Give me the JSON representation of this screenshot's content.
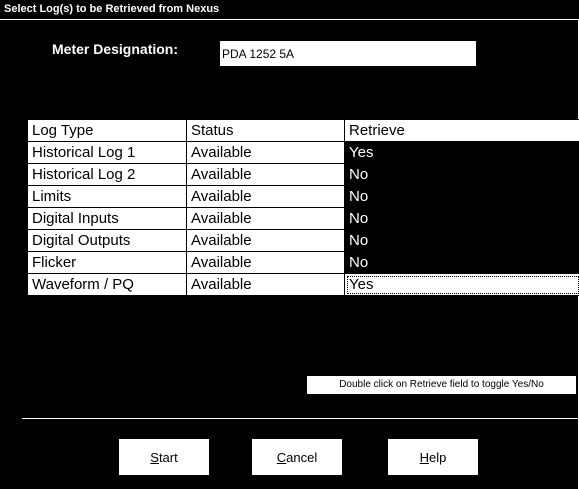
{
  "window": {
    "title": "Select Log(s) to be Retrieved from Nexus"
  },
  "meter": {
    "label": "Meter Designation:",
    "value": "PDA 1252 5A"
  },
  "table": {
    "headers": [
      "Log Type",
      "Status",
      "Retrieve"
    ],
    "rows": [
      [
        "Historical Log 1",
        "Available",
        "Yes"
      ],
      [
        "Historical Log 2",
        "Available",
        "No"
      ],
      [
        "Limits",
        "Available",
        "No"
      ],
      [
        "Digital Inputs",
        "Available",
        "No"
      ],
      [
        "Digital Outputs",
        "Available",
        "No"
      ],
      [
        "Flicker",
        "Available",
        "No"
      ],
      [
        "Waveform / PQ",
        "Available",
        "Yes"
      ]
    ]
  },
  "hint": "Double click on Retrieve field to toggle Yes/No",
  "buttons": {
    "start": {
      "mnemonic": "S",
      "rest": "tart"
    },
    "cancel": {
      "mnemonic": "C",
      "rest": "ancel"
    },
    "help": {
      "mnemonic": "H",
      "rest": "elp"
    }
  }
}
